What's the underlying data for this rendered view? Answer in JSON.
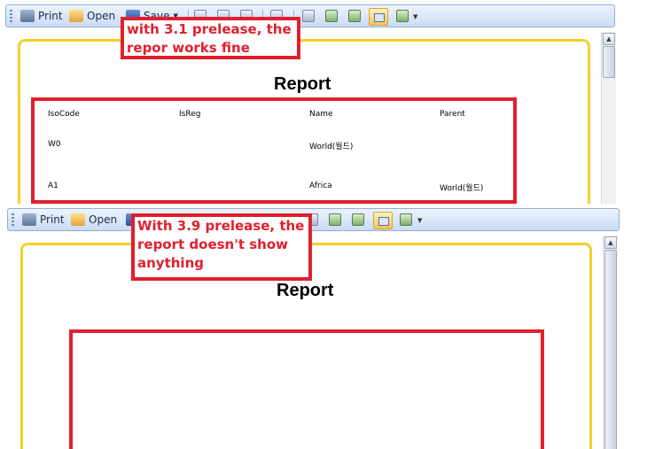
{
  "toolbar": {
    "print_label": "Print",
    "open_label": "Open",
    "save_label": "Save"
  },
  "report": {
    "title": "Report"
  },
  "table": {
    "headers": [
      "IsoCode",
      "IsReg",
      "Name",
      "Parent"
    ],
    "rows": [
      [
        "W0",
        "",
        "World(월드)",
        ""
      ],
      [
        "A1",
        "",
        "Africa",
        "World(월드)"
      ]
    ]
  },
  "annotations": {
    "top": "with 3.1 prelease, the repor works fine",
    "bottom": "With 3.9 prelease, the report doesn't show anything"
  },
  "colors": {
    "annotation_red": "#e0202e",
    "page_border": "#f4cf2b",
    "toolbar_selected": "#f6c55d"
  },
  "icons": [
    "print-icon",
    "open-icon",
    "save-icon",
    "page-setup-icon",
    "delete-icon",
    "export-icon",
    "binoculars-icon",
    "single-page-icon",
    "two-page-icon",
    "book-icon",
    "page-width-icon",
    "multi-page-icon"
  ]
}
